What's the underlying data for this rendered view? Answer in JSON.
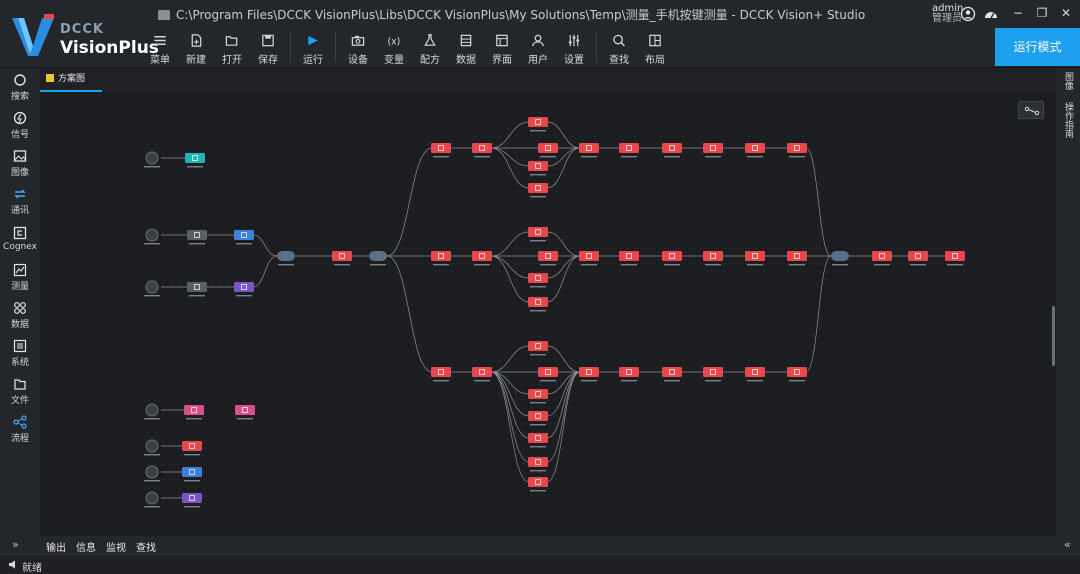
{
  "window": {
    "brand_top": "DCCK",
    "brand_main": "VisionPlus",
    "title": "C:\\Program Files\\DCCK VisionPlus\\Libs\\DCCK VisionPlus\\My Solutions\\Temp\\测量_手机按键测量 - DCCK Vision+ Studio"
  },
  "toolbar": {
    "menu": "菜单",
    "new": "新建",
    "open": "打开",
    "save": "保存",
    "run": "运行",
    "device": "设备",
    "variable": "变量",
    "recipe": "配方",
    "data": "数据",
    "ui": "界面",
    "user": "用户",
    "settings": "设置",
    "find": "查找",
    "layout": "布局"
  },
  "user": {
    "name": "admin",
    "role": "管理员"
  },
  "run_mode": "运行模式",
  "sidebar": {
    "items": [
      {
        "label": "搜索",
        "icon": "search-icon"
      },
      {
        "label": "信号",
        "icon": "signal-icon"
      },
      {
        "label": "图像",
        "icon": "image-icon"
      },
      {
        "label": "通讯",
        "icon": "communication-icon"
      },
      {
        "label": "Cognex",
        "icon": "cognex-icon"
      },
      {
        "label": "测量",
        "icon": "measure-icon"
      },
      {
        "label": "数据",
        "icon": "data-icon"
      },
      {
        "label": "系统",
        "icon": "system-icon"
      },
      {
        "label": "文件",
        "icon": "file-icon"
      },
      {
        "label": "流程",
        "icon": "flow-icon"
      }
    ]
  },
  "tab": {
    "label": "方案图"
  },
  "right_panel": {
    "tab1": "图像",
    "tab2": "操作指南"
  },
  "bottom": {
    "output": "输出",
    "info": "信息",
    "monitor": "监视",
    "find": "查找"
  },
  "status": "就绪",
  "colors": {
    "accent": "#1ea0f0",
    "node_red": "#e8474c",
    "node_teal": "#1fb5b0",
    "node_blue": "#3d7fdc",
    "node_purple": "#7a55c9",
    "node_pink": "#d94f8c",
    "node_gray": "#5a5f67"
  }
}
